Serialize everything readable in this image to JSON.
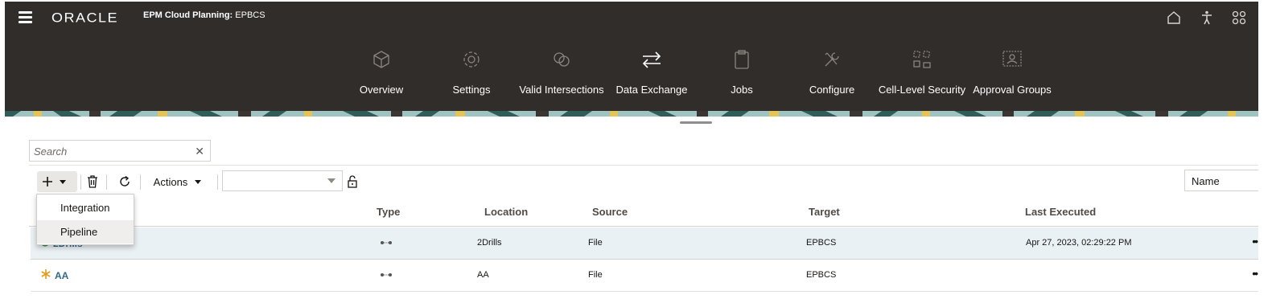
{
  "header": {
    "brand": "ORACLE",
    "app_name_bold": "EPM Cloud Planning:",
    "app_name": "EPBCS",
    "icons": [
      "home-icon",
      "accessibility-icon",
      "apps-grid-icon"
    ]
  },
  "nav": {
    "items": [
      {
        "label": "Overview",
        "icon": "cube-icon"
      },
      {
        "label": "Settings",
        "icon": "gear-icon"
      },
      {
        "label": "Valid Intersections",
        "icon": "intersections-icon"
      },
      {
        "label": "Data Exchange",
        "icon": "exchange-arrows-icon"
      },
      {
        "label": "Jobs",
        "icon": "clipboard-icon"
      },
      {
        "label": "Configure",
        "icon": "tools-icon"
      },
      {
        "label": "Cell-Level Security",
        "icon": "cell-security-icon"
      },
      {
        "label": "Approval Groups",
        "icon": "approval-groups-icon"
      }
    ]
  },
  "search": {
    "placeholder": "Search",
    "value": ""
  },
  "toolbar": {
    "actions_label": "Actions",
    "sort_label": "Name",
    "filter_value": ""
  },
  "popup_menu": {
    "items": [
      "Integration",
      "Pipeline"
    ],
    "highlighted": "Pipeline"
  },
  "table": {
    "columns": [
      "Type",
      "Location",
      "Source",
      "Target",
      "Last Executed"
    ],
    "rows": [
      {
        "name": "2Drills",
        "status": "success",
        "location": "2Drills",
        "source": "File",
        "target": "EPBCS",
        "last_executed": "Apr 27, 2023, 02:29:22 PM"
      },
      {
        "name": "AA",
        "status": "new",
        "location": "AA",
        "source": "File",
        "target": "EPBCS",
        "last_executed": ""
      }
    ]
  },
  "colors": {
    "header_bg": "#312d2a",
    "link": "#2e6a8f",
    "selected_row": "#eaf1f4",
    "success": "#2e8b3a",
    "new_star": "#e39c1a"
  }
}
